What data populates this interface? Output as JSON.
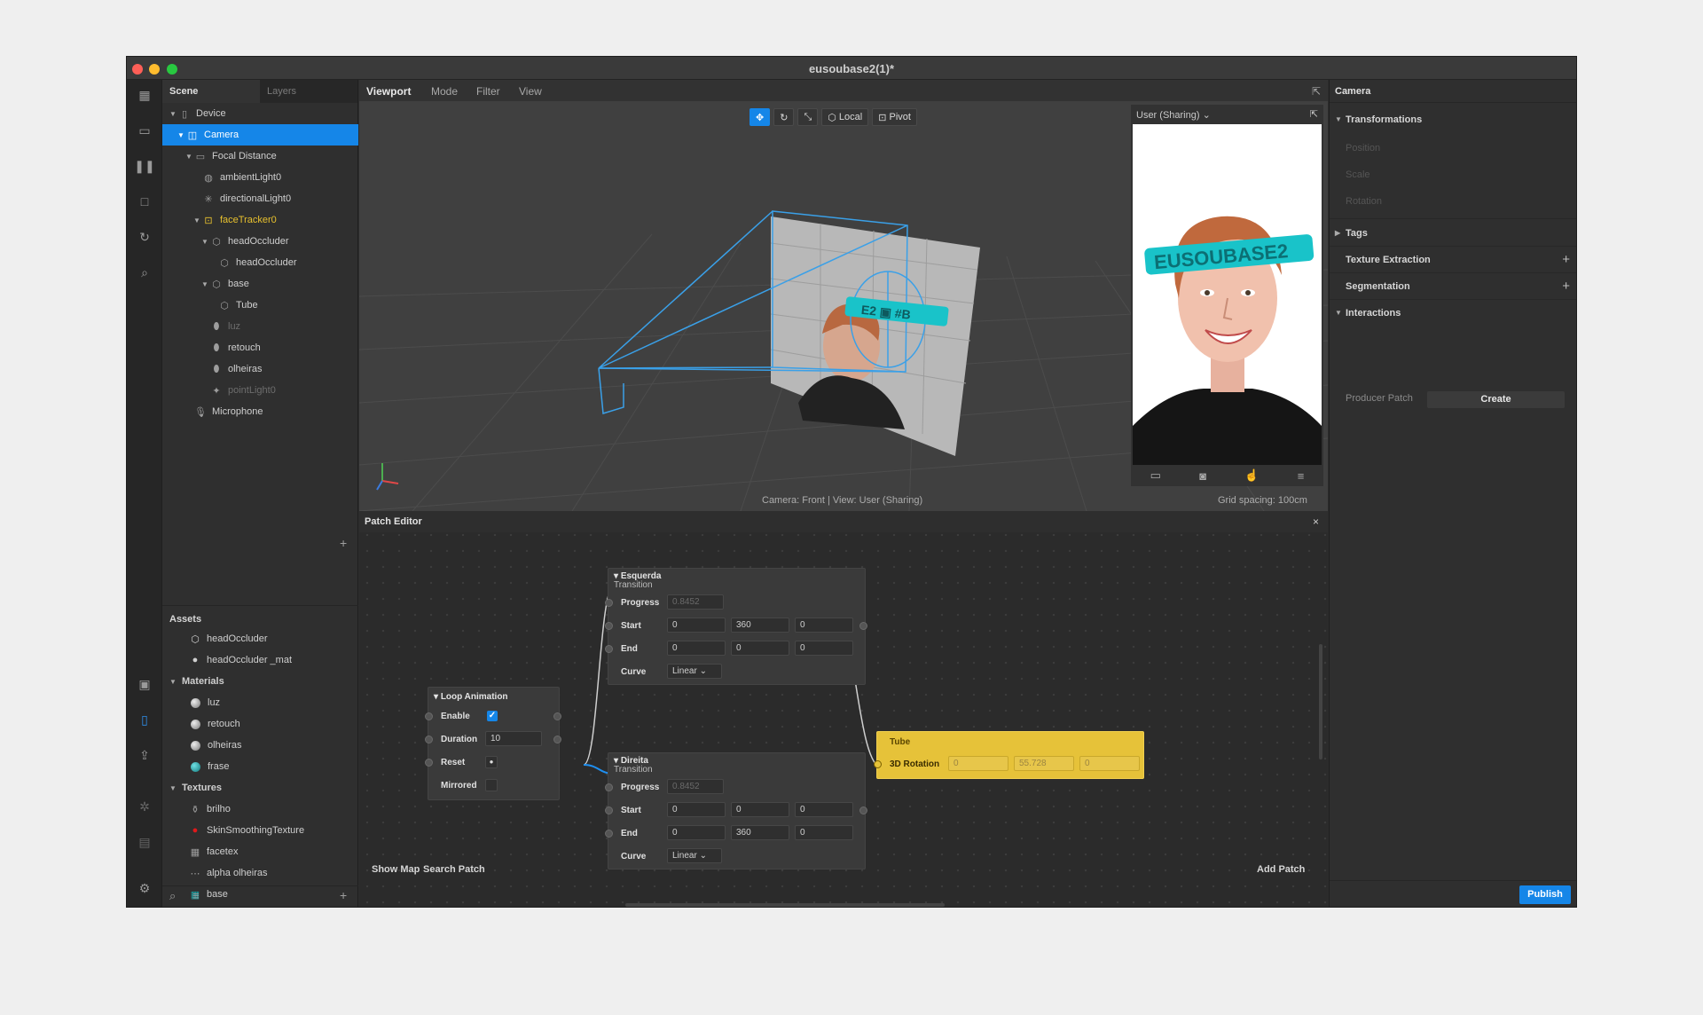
{
  "window": {
    "title": "eusoubase2(1)*"
  },
  "scene_panel": {
    "tab_scene": "Scene",
    "tab_layers": "Layers",
    "tree": [
      {
        "label": "Device",
        "indent": 0,
        "toggle": "▼",
        "icon": "▯"
      },
      {
        "label": "Camera",
        "indent": 1,
        "toggle": "▼",
        "icon": "◫",
        "selected": true
      },
      {
        "label": "Focal Distance",
        "indent": 2,
        "toggle": "▼",
        "icon": "▭"
      },
      {
        "label": "ambientLight0",
        "indent": 3,
        "toggle": "",
        "icon": "◍"
      },
      {
        "label": "directionalLight0",
        "indent": 3,
        "toggle": "",
        "icon": "✳"
      },
      {
        "label": "faceTracker0",
        "indent": 3,
        "toggle": "▼",
        "icon": "⊡",
        "highlight": true
      },
      {
        "label": "headOccluder",
        "indent": 4,
        "toggle": "▼",
        "icon": "⬡"
      },
      {
        "label": "headOccluder",
        "indent": 5,
        "toggle": "",
        "icon": "⬡"
      },
      {
        "label": "base",
        "indent": 4,
        "toggle": "▼",
        "icon": "⬡"
      },
      {
        "label": "Tube",
        "indent": 5,
        "toggle": "",
        "icon": "⬡"
      },
      {
        "label": "luz",
        "indent": 4,
        "toggle": "",
        "icon": "⬮",
        "dim": true
      },
      {
        "label": "retouch",
        "indent": 4,
        "toggle": "",
        "icon": "⬮"
      },
      {
        "label": "olheiras",
        "indent": 4,
        "toggle": "",
        "icon": "⬮"
      },
      {
        "label": "pointLight0",
        "indent": 4,
        "toggle": "",
        "icon": "✦",
        "dim": true
      },
      {
        "label": "Microphone",
        "indent": 2,
        "toggle": "",
        "icon": "🎙"
      }
    ],
    "assets_title": "Assets",
    "assets_items": [
      {
        "label": "headOccluder",
        "icon": "⬡"
      },
      {
        "label": "headOccluder _mat",
        "icon": "●"
      }
    ],
    "materials_title": "Materials",
    "materials": [
      "luz",
      "retouch",
      "olheiras",
      "frase"
    ],
    "textures_title": "Textures",
    "textures": [
      {
        "label": "brilho",
        "icon": "⚱"
      },
      {
        "label": "SkinSmoothingTexture",
        "icon": "●",
        "color": "#e0191b"
      },
      {
        "label": "facetex",
        "icon": "▦"
      },
      {
        "label": "alpha olheiras",
        "icon": "⋯"
      },
      {
        "label": "base",
        "icon": "▦",
        "color": "#1aa6a8"
      }
    ]
  },
  "viewport": {
    "tabs": [
      "Viewport",
      "Mode",
      "Filter",
      "View"
    ],
    "tool_local": "Local",
    "tool_pivot": "Pivot",
    "caption": "Camera: Front | View: User (Sharing)",
    "grid_spacing": "Grid spacing: 100cm",
    "simulator_view": "User (Sharing)",
    "ar_text": "EUSOUBASE2"
  },
  "patch_editor": {
    "title": "Patch Editor",
    "show_map": "Show Map",
    "search_patch": "Search Patch",
    "add_patch": "Add Patch",
    "loop": {
      "title": "Loop Animation",
      "enable": "Enable",
      "duration": "Duration",
      "duration_value": "10",
      "reset": "Reset",
      "mirrored": "Mirrored"
    },
    "esquerda": {
      "title": "Esquerda",
      "subtitle": "Transition",
      "progress": "Progress",
      "progress_value": "0.8452",
      "start": "Start",
      "start_values": [
        "0",
        "360",
        "0"
      ],
      "end": "End",
      "end_values": [
        "0",
        "0",
        "0"
      ],
      "curve": "Curve",
      "curve_value": "Linear"
    },
    "direita": {
      "title": "Direita",
      "subtitle": "Transition",
      "progress": "Progress",
      "progress_value": "0.8452",
      "start": "Start",
      "start_values": [
        "0",
        "0",
        "0"
      ],
      "end": "End",
      "end_values": [
        "0",
        "360",
        "0"
      ],
      "curve": "Curve",
      "curve_value": "Linear"
    },
    "tube": {
      "title": "Tube",
      "rotation": "3D Rotation",
      "values": [
        "0",
        "55.728",
        "0"
      ]
    }
  },
  "inspector": {
    "title": "Camera",
    "transformations": "Transformations",
    "position": "Position",
    "scale": "Scale",
    "rotation": "Rotation",
    "tags": "Tags",
    "texture_extraction": "Texture Extraction",
    "segmentation": "Segmentation",
    "interactions": "Interactions",
    "producer_patch": "Producer Patch",
    "create": "Create",
    "publish": "Publish"
  },
  "colors": {
    "accent": "#1586e8",
    "tube_node": "#e6c239",
    "highlight": "#e7c02e",
    "ar_cyan": "#19c3c9"
  }
}
